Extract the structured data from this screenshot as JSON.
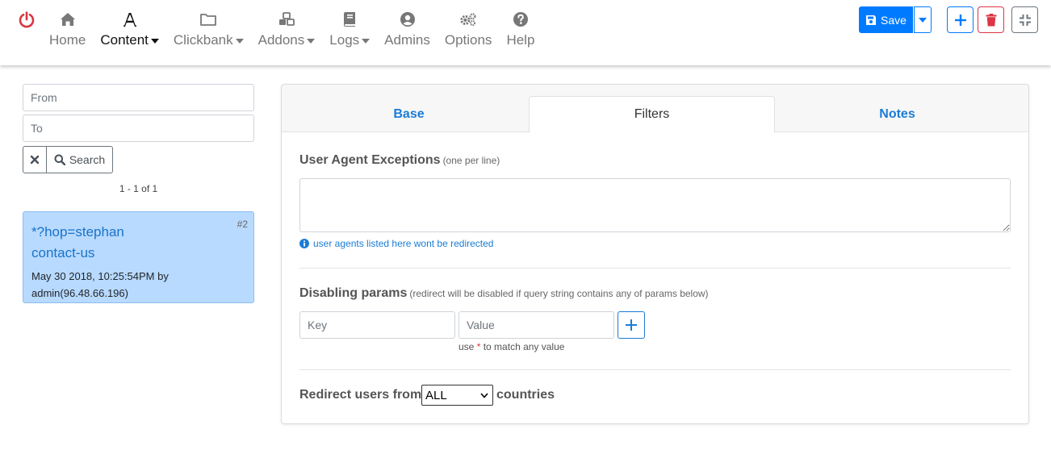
{
  "nav": {
    "items": [
      {
        "label": "Home",
        "icon": "home-icon",
        "dropdown": false
      },
      {
        "label": "Content",
        "icon": "font-icon",
        "dropdown": true,
        "active": true
      },
      {
        "label": "Clickbank",
        "icon": "folder-icon",
        "dropdown": true
      },
      {
        "label": "Addons",
        "icon": "cubes-icon",
        "dropdown": true
      },
      {
        "label": "Logs",
        "icon": "book-icon",
        "dropdown": true
      },
      {
        "label": "Admins",
        "icon": "user-circle-icon",
        "dropdown": false
      },
      {
        "label": "Options",
        "icon": "cogs-icon",
        "dropdown": false
      },
      {
        "label": "Help",
        "icon": "question-circle-icon",
        "dropdown": false
      }
    ]
  },
  "toolbar": {
    "save_label": "Save"
  },
  "filters": {
    "from_placeholder": "From",
    "to_placeholder": "To",
    "search_label": "Search",
    "pager": "1 - 1 of 1"
  },
  "record": {
    "id": "#2",
    "title_line1": "*?hop=stephan",
    "title_line2": "contact-us",
    "meta_line1": "May 30 2018, 10:25:54PM by",
    "meta_line2": "admin(96.48.66.196)"
  },
  "tabs": [
    {
      "label": "Base"
    },
    {
      "label": "Filters"
    },
    {
      "label": "Notes"
    }
  ],
  "form": {
    "ua_label": "User Agent Exceptions",
    "ua_sub": "(one per line)",
    "ua_hint": "user agents listed here wont be redirected",
    "params_label": "Disabling params",
    "params_sub": "(redirect will be disabled if query string contains any of params below)",
    "key_placeholder": "Key",
    "value_placeholder": "Value",
    "note_pre": "use",
    "note_star": "*",
    "note_post": "to match any value",
    "redirect_pre": "Redirect users from",
    "redirect_select": "ALL",
    "redirect_post": "countries"
  },
  "colors": {
    "primary": "#007bff",
    "danger": "#dc3545",
    "power": "#d9363e",
    "record_bg": "#b8daff",
    "link": "#1a7cd6"
  }
}
